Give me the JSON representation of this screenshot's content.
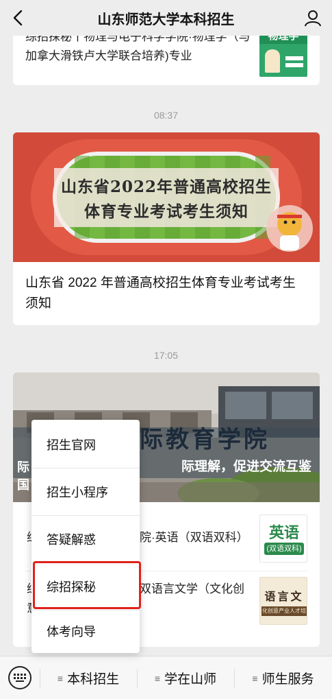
{
  "navbar": {
    "title": "山东师范大学本科招生",
    "back_icon": "chevron-left-icon",
    "user_icon": "user-profile-icon"
  },
  "feed": {
    "top_article": {
      "text": "综招探秘丨物理与电子科学学院·物理学（与加拿大滑铁卢大学联合培养)专业",
      "thumb_label": "物理学"
    },
    "time_1": "08:37",
    "sport_article": {
      "banner_line1": "山东省2022年普通高校招生",
      "banner_line2": "体育专业考试考生须知",
      "title": "山东省 2022 年普通高校招生体育专业考试考生须知"
    },
    "time_2": "17:05",
    "intl_article": {
      "banner_title": "际教育学院",
      "banner_sub": "际理解，促进交流互鉴",
      "banner_left_1": "际",
      "banner_left_2": "国",
      "row1_prefix": "综",
      "row1_text": "院·英语（双语双科）",
      "row1_thumb_main": "英语",
      "row1_thumb_sub": "(双语双科)",
      "row2_prefix": "综",
      "row2_prefix2": "意",
      "row2_text": "双语言文学（文化创",
      "row2_thumb_main": "语言文",
      "row2_thumb_sub": "化创意产业人才培"
    }
  },
  "popup_menu": {
    "items": [
      "招生官网",
      "招生小程序",
      "答疑解惑",
      "综招探秘",
      "体考向导"
    ],
    "highlighted": "综招探秘"
  },
  "bottom_bar": {
    "keyboard_icon": "keyboard-icon",
    "menus": [
      "本科招生",
      "学在山师",
      "师生服务"
    ],
    "menu_icon": "≡"
  }
}
